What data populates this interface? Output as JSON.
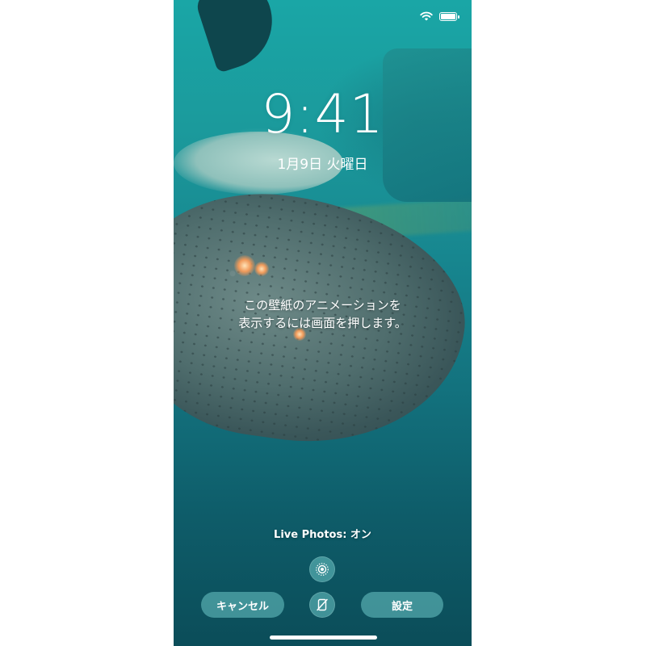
{
  "lockscreen": {
    "time": "9:41",
    "date": "1月9日 火曜日",
    "hint_line1": "この壁紙のアニメーションを",
    "hint_line2": "表示するには画面を押します。",
    "live_photos_status": "Live Photos: オン"
  },
  "buttons": {
    "cancel_label": "キャンセル",
    "set_label": "設定"
  },
  "icons": {
    "status": [
      "wifi-icon",
      "battery-icon"
    ],
    "live_toggle": "live-photo-icon",
    "perspective": "perspective-zoom-icon"
  },
  "colors": {
    "text": "#ffffff",
    "button_bg": "#6ec8c8"
  }
}
